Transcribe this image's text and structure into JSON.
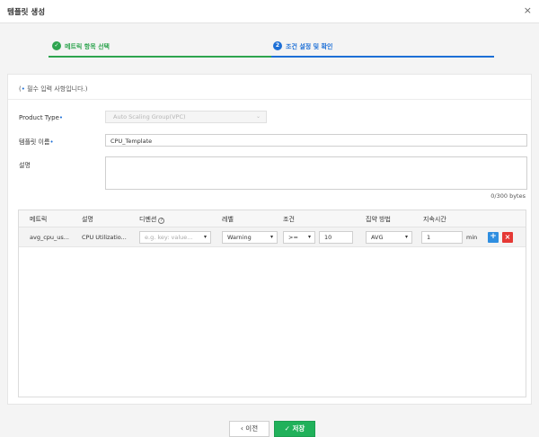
{
  "dialog": {
    "title": "템플릿 생성",
    "close_icon": "×"
  },
  "steps": [
    {
      "index": "✓",
      "label": "메트릭 항목 선택",
      "state": "completed",
      "color": "#2ea44f"
    },
    {
      "index": "2",
      "label": "조건 설정 및 확인",
      "state": "active",
      "color": "#1d6fd6"
    }
  ],
  "form": {
    "required_note_prefix": "(",
    "required_star": "•",
    "required_note": " 필수 입력 사항입니다.)",
    "product_type_label": "Product Type",
    "product_type_value": "Auto Scaling Group(VPC)",
    "template_name_label": "템플릿 이름",
    "template_name_value": "CPU_Template",
    "description_label": "설명",
    "description_value": "",
    "description_counter": "0/300 bytes"
  },
  "table": {
    "headers": {
      "metric": "메트릭",
      "description": "설명",
      "dimension": "디멘션",
      "level": "레벨",
      "condition": "조건",
      "aggregation": "집약 방법",
      "duration": "지속시간"
    },
    "rows": [
      {
        "metric": "avg_cpu_us...",
        "description": "CPU Utilizatio...",
        "dimension_placeholder": "e.g. key: value...",
        "level": "Warning",
        "operator": ">=",
        "threshold": "10",
        "aggregation": "AVG",
        "duration": "1",
        "duration_unit": "min",
        "add": "+",
        "remove": "×"
      }
    ]
  },
  "footer": {
    "prev_label": "‹  이전",
    "save_label": "✓ 저장"
  },
  "colors": {
    "accent": "#1d6fd6",
    "success": "#2ea44f",
    "save": "#20b15a",
    "danger": "#e53935",
    "add": "#2f8ee0"
  }
}
